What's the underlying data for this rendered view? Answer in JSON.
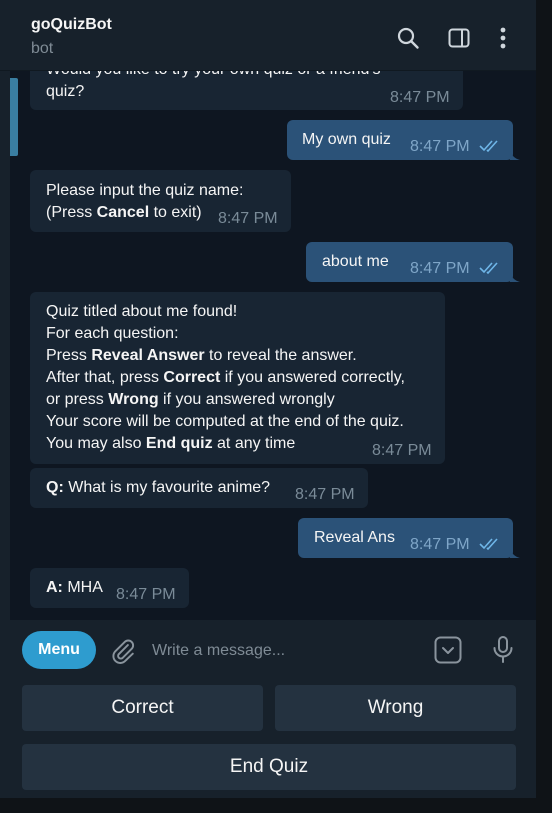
{
  "header": {
    "title": "goQuizBot",
    "subtitle": "bot"
  },
  "messages": {
    "m1": {
      "line1": "Would you like to try your own quiz or a friend's",
      "line2": "quiz?",
      "time": "8:47 PM"
    },
    "m2": {
      "text": "My own quiz",
      "time": "8:47 PM"
    },
    "m3": {
      "line1": "Please input the quiz name:",
      "line2_pre": "(Press ",
      "line2_bold": "Cancel",
      "line2_post": " to exit)",
      "time": "8:47 PM"
    },
    "m4": {
      "text": "about me",
      "time": "8:47 PM"
    },
    "m5": {
      "line1": "Quiz titled about me found!",
      "line2": "For each question:",
      "line3_pre": "Press ",
      "line3_bold": "Reveal Answer",
      "line3_post": " to reveal the answer.",
      "line4_pre": "After that, press ",
      "line4_bold": "Correct",
      "line4_post": " if you answered correctly,",
      "line5_pre": "or press ",
      "line5_bold": "Wrong",
      "line5_post": " if you answered wrongly",
      "line6": "Your score will be computed at the end of the quiz.",
      "line7_pre": "You may also ",
      "line7_bold": "End quiz",
      "line7_post": " at any time",
      "time": "8:47 PM"
    },
    "m6": {
      "label": "Q:",
      "text": " What is my favourite anime?",
      "time": "8:47 PM"
    },
    "m7": {
      "text": "Reveal Ans",
      "time": "8:47 PM"
    },
    "m8": {
      "label": "A:",
      "text": " MHA",
      "time": "8:47 PM"
    }
  },
  "composer": {
    "menu_label": "Menu",
    "placeholder": "Write a message..."
  },
  "keyboard": {
    "correct": "Correct",
    "wrong": "Wrong",
    "end_quiz": "End Quiz"
  },
  "colors": {
    "accent": "#2e9ccf",
    "outgoing": "#2b5278",
    "incoming": "#182533",
    "background": "#0e1621"
  },
  "icons": [
    "search-icon",
    "sidebar-toggle-icon",
    "more-vertical-icon",
    "attach-icon",
    "emoji-icon",
    "microphone-icon",
    "double-check-icon"
  ]
}
